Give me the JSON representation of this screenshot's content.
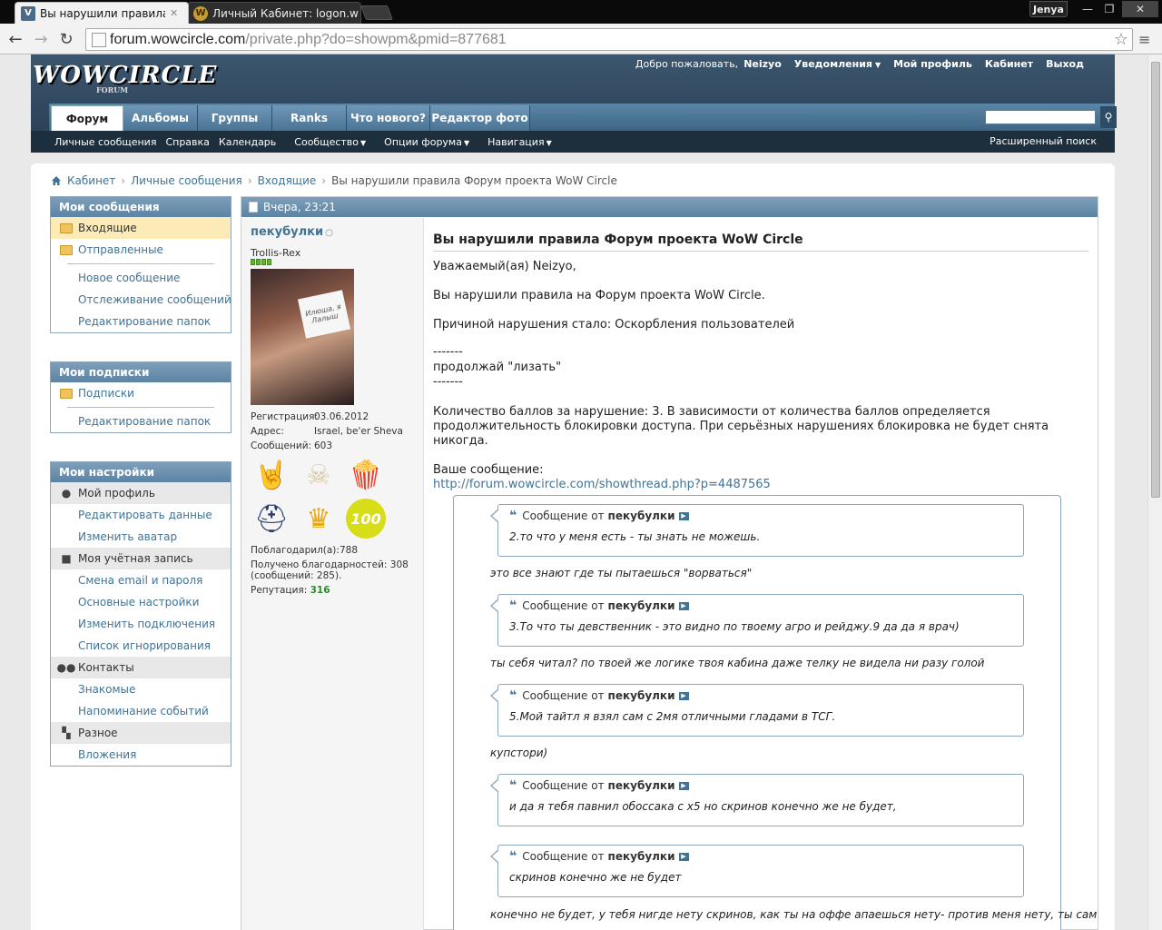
{
  "browser": {
    "tabs": [
      {
        "title": "Вы нарушили правила Ф",
        "icon": "forum-favicon"
      },
      {
        "title": "Личный Кабинет: logon.w",
        "icon": "wow-favicon"
      }
    ],
    "profile_name": "Jenya",
    "url_host": "forum.wowcircle.com",
    "url_path": "/private.php?do=showpm&pmid=877681"
  },
  "header": {
    "logo": "WOWCIRCLE",
    "logo_sub": "FORUM",
    "welcome": "Добро пожаловать,",
    "username": "Neizyo",
    "links": [
      "Уведомления",
      "Мой профиль",
      "Кабинет",
      "Выход"
    ],
    "nav_tabs": [
      "Форум",
      "Альбомы",
      "Группы",
      "Ranks",
      "Что нового?",
      "Редактор фото"
    ],
    "subnav": [
      "Личные сообщения",
      "Справка",
      "Календарь",
      "Сообщество",
      "Опции форума",
      "Навигация"
    ],
    "advanced_search": "Расширенный поиск"
  },
  "breadcrumb": [
    "Кабинет",
    "Личные сообщения",
    "Входящие",
    "Вы нарушили правила Форум проекта WoW Circle"
  ],
  "sidebar": {
    "messages": {
      "title": "Мои сообщения",
      "folders": [
        "Входящие",
        "Отправленные"
      ],
      "links": [
        "Новое сообщение",
        "Отслеживание сообщений",
        "Редактирование папок"
      ]
    },
    "subscriptions": {
      "title": "Мои подписки",
      "folders": [
        "Подписки"
      ],
      "links": [
        "Редактирование папок"
      ]
    },
    "settings": {
      "title": "Мои настройки",
      "groups": [
        {
          "label": "Мой профиль",
          "items": [
            "Редактировать данные",
            "Изменить аватар"
          ]
        },
        {
          "label": "Моя учётная запись",
          "items": [
            "Смена email и пароля",
            "Основные настройки",
            "Изменить подключения",
            "Список игнорирования"
          ]
        },
        {
          "label": "Контакты",
          "items": [
            "Знакомые",
            "Напоминание событий"
          ]
        },
        {
          "label": "Разное",
          "items": [
            "Вложения"
          ]
        }
      ]
    }
  },
  "post": {
    "date": "Вчера, 23:21",
    "author": "пекубулки",
    "user_title": "Trollis-Rex",
    "avatar_note": "Илюша, я Лалыш",
    "stats": [
      {
        "label": "Регистрация:",
        "value": "03.06.2012"
      },
      {
        "label": "Адрес:",
        "value": "Israel, be'er Sheva"
      },
      {
        "label": "Сообщений:",
        "value": "603"
      }
    ],
    "thanks_given": "Поблагодарил(а):",
    "thanks_given_value": "788",
    "thanks_received": "Получено благодарностей: 308",
    "thanks_received2": "(сообщений: 285).",
    "reputation_label": "Репутация:",
    "reputation": "316",
    "award_100": "100",
    "title": "Вы нарушили правила Форум проекта WoW Circle",
    "lines": [
      "Уважаемый(ая) Neizyo,",
      "Вы нарушили правила на Форум проекта WoW Circle.",
      "Причиной нарушения стало: Оскорбления пользователей",
      "-------",
      "продолжай \"лизать\"",
      "-------",
      "Количество баллов за нарушение: 3. В зависимости от количества баллов определяется",
      "продолжительность блокировки доступа. При серьёзных нарушениях блокировка не будет снята",
      "никогда.",
      "Ваше сообщение:"
    ],
    "link": "http://forum.wowcircle.com/showthread.php?p=4487565",
    "quote_prefix": "Сообщение от",
    "quotes": [
      {
        "author": "пекубулки",
        "text": "2.то что у меня есть - ты знать не можешь.",
        "reply": "это все знают где ты пытаешься \"ворваться\""
      },
      {
        "author": "пекубулки",
        "text": "3.То что ты девственник - это видно по твоему агро и рейджу.9 да да я врач)",
        "reply": "ты себя читал? по твоей же логике твоя кабина даже телку не видела ни разу голой"
      },
      {
        "author": "пекубулки",
        "text": "5.Мой тайтл я взял сам с 2мя отличными гладами в ТСГ.",
        "reply": "купстори)"
      },
      {
        "author": "пекубулки",
        "text": "и да я тебя павнил обоссака с х5 но скринов конечно же не будет,",
        "reply": ""
      },
      {
        "author": "пекубулки",
        "text": "скринов конечно же не будет",
        "reply": "конечно не будет, у тебя нигде нету скринов, как ты на оффе апаешься нету- против меня нету, ты сам"
      }
    ]
  }
}
